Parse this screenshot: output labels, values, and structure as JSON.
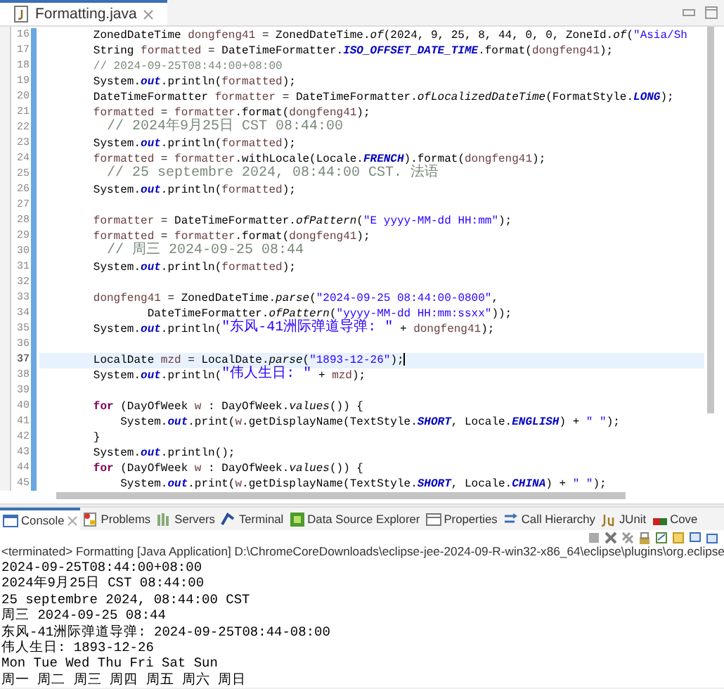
{
  "editor": {
    "tab": {
      "title": "Formatting.java",
      "selected": true
    },
    "lines": [
      {
        "number": "16",
        "current": false,
        "tokens": [
          {
            "text": "        ZonedDateTime ",
            "kind": "plain"
          },
          {
            "text": "dongfeng41",
            "kind": "variable"
          },
          {
            "text": " = ZonedDateTime.",
            "kind": "plain"
          },
          {
            "text": "of",
            "kind": "static-method"
          },
          {
            "text": "(2024, 9, 25, 8, 44, 0, 0, ZoneId.",
            "kind": "plain"
          },
          {
            "text": "of",
            "kind": "static-method"
          },
          {
            "text": "(",
            "kind": "plain"
          },
          {
            "text": "\"Asia/Sh",
            "kind": "string"
          }
        ]
      },
      {
        "number": "17",
        "current": false,
        "tokens": [
          {
            "text": "        String ",
            "kind": "plain"
          },
          {
            "text": "formatted",
            "kind": "variable"
          },
          {
            "text": " = DateTimeFormatter.",
            "kind": "plain"
          },
          {
            "text": "ISO_OFFSET_DATE_TIME",
            "kind": "constant"
          },
          {
            "text": ".format(",
            "kind": "plain"
          },
          {
            "text": "dongfeng41",
            "kind": "variable"
          },
          {
            "text": ");",
            "kind": "plain"
          }
        ]
      },
      {
        "number": "18",
        "current": false,
        "tokens": [
          {
            "text": "        // 2024-09-25T08:44:00+08:00",
            "kind": "comment"
          }
        ]
      },
      {
        "number": "19",
        "current": false,
        "tokens": [
          {
            "text": "        System.",
            "kind": "plain"
          },
          {
            "text": "out",
            "kind": "field"
          },
          {
            "text": ".println(",
            "kind": "plain"
          },
          {
            "text": "formatted",
            "kind": "variable"
          },
          {
            "text": ");",
            "kind": "plain"
          }
        ]
      },
      {
        "number": "20",
        "current": false,
        "tokens": [
          {
            "text": "        DateTimeFormatter ",
            "kind": "plain"
          },
          {
            "text": "formatter",
            "kind": "variable"
          },
          {
            "text": " = DateTimeFormatter.",
            "kind": "plain"
          },
          {
            "text": "ofLocalizedDateTime",
            "kind": "static-method"
          },
          {
            "text": "(FormatStyle.",
            "kind": "plain"
          },
          {
            "text": "LONG",
            "kind": "constant"
          },
          {
            "text": ");",
            "kind": "plain"
          }
        ]
      },
      {
        "number": "21",
        "current": false,
        "tokens": [
          {
            "text": "        formatted",
            "kind": "variable"
          },
          {
            "text": " = ",
            "kind": "plain"
          },
          {
            "text": "formatter",
            "kind": "variable"
          },
          {
            "text": ".format(",
            "kind": "plain"
          },
          {
            "text": "dongfeng41",
            "kind": "variable"
          },
          {
            "text": ");",
            "kind": "plain"
          }
        ]
      },
      {
        "number": "22",
        "current": false,
        "tokens": [
          {
            "text": "        // 2024年9月25日 CST 08:44:00",
            "kind": "comment"
          }
        ]
      },
      {
        "number": "23",
        "current": false,
        "tokens": [
          {
            "text": "        System.",
            "kind": "plain"
          },
          {
            "text": "out",
            "kind": "field"
          },
          {
            "text": ".println(",
            "kind": "plain"
          },
          {
            "text": "formatted",
            "kind": "variable"
          },
          {
            "text": ");",
            "kind": "plain"
          }
        ]
      },
      {
        "number": "24",
        "current": false,
        "tokens": [
          {
            "text": "        formatted",
            "kind": "variable"
          },
          {
            "text": " = ",
            "kind": "plain"
          },
          {
            "text": "formatter",
            "kind": "variable"
          },
          {
            "text": ".withLocale(Locale.",
            "kind": "plain"
          },
          {
            "text": "FRENCH",
            "kind": "constant"
          },
          {
            "text": ").format(",
            "kind": "plain"
          },
          {
            "text": "dongfeng41",
            "kind": "variable"
          },
          {
            "text": ");",
            "kind": "plain"
          }
        ]
      },
      {
        "number": "25",
        "current": false,
        "tokens": [
          {
            "text": "        // 25 septembre 2024, 08:44:00 CST. 法语",
            "kind": "comment"
          }
        ]
      },
      {
        "number": "26",
        "current": false,
        "tokens": [
          {
            "text": "        System.",
            "kind": "plain"
          },
          {
            "text": "out",
            "kind": "field"
          },
          {
            "text": ".println(",
            "kind": "plain"
          },
          {
            "text": "formatted",
            "kind": "variable"
          },
          {
            "text": ");",
            "kind": "plain"
          }
        ]
      },
      {
        "number": "27",
        "current": false
      },
      {
        "number": "28",
        "current": false,
        "tokens": [
          {
            "text": "        formatter",
            "kind": "variable"
          },
          {
            "text": " = DateTimeFormatter.",
            "kind": "plain"
          },
          {
            "text": "ofPattern",
            "kind": "static-method"
          },
          {
            "text": "(",
            "kind": "plain"
          },
          {
            "text": "\"E yyyy-MM-dd HH:mm\"",
            "kind": "string"
          },
          {
            "text": ");",
            "kind": "plain"
          }
        ]
      },
      {
        "number": "29",
        "current": false,
        "tokens": [
          {
            "text": "        formatted",
            "kind": "variable"
          },
          {
            "text": " = ",
            "kind": "plain"
          },
          {
            "text": "formatter",
            "kind": "variable"
          },
          {
            "text": ".format(",
            "kind": "plain"
          },
          {
            "text": "dongfeng41",
            "kind": "variable"
          },
          {
            "text": ");",
            "kind": "plain"
          }
        ]
      },
      {
        "number": "30",
        "current": false,
        "tokens": [
          {
            "text": "        // 周三 2024-09-25 08:44",
            "kind": "comment"
          }
        ]
      },
      {
        "number": "31",
        "current": false,
        "tokens": [
          {
            "text": "        System.",
            "kind": "plain"
          },
          {
            "text": "out",
            "kind": "field"
          },
          {
            "text": ".println(",
            "kind": "plain"
          },
          {
            "text": "formatted",
            "kind": "variable"
          },
          {
            "text": ");",
            "kind": "plain"
          }
        ]
      },
      {
        "number": "32",
        "current": false
      },
      {
        "number": "33",
        "current": false,
        "tokens": [
          {
            "text": "        dongfeng41",
            "kind": "variable"
          },
          {
            "text": " = ZonedDateTime.",
            "kind": "plain"
          },
          {
            "text": "parse",
            "kind": "static-method"
          },
          {
            "text": "(",
            "kind": "plain"
          },
          {
            "text": "\"2024-09-25 08:44:00-0800\"",
            "kind": "string"
          },
          {
            "text": ",",
            "kind": "plain"
          }
        ]
      },
      {
        "number": "34",
        "current": false,
        "tokens": [
          {
            "text": "                DateTimeFormatter.",
            "kind": "plain"
          },
          {
            "text": "ofPattern",
            "kind": "static-method"
          },
          {
            "text": "(",
            "kind": "plain"
          },
          {
            "text": "\"yyyy-MM-dd HH:mm:ssxx\"",
            "kind": "string"
          },
          {
            "text": "));",
            "kind": "plain"
          }
        ]
      },
      {
        "number": "35",
        "current": false,
        "tokens": [
          {
            "text": "        System.",
            "kind": "plain"
          },
          {
            "text": "out",
            "kind": "field"
          },
          {
            "text": ".println(",
            "kind": "plain"
          },
          {
            "text": "\"东风-41洲际弹道导弹: \"",
            "kind": "string"
          },
          {
            "text": " + ",
            "kind": "plain"
          },
          {
            "text": "dongfeng41",
            "kind": "variable"
          },
          {
            "text": ");",
            "kind": "plain"
          }
        ]
      },
      {
        "number": "36",
        "current": false
      },
      {
        "number": "37",
        "current": true,
        "tokens": [
          {
            "text": "        LocalDate ",
            "kind": "plain"
          },
          {
            "text": "mzd",
            "kind": "variable"
          },
          {
            "text": " = LocalDate.",
            "kind": "plain"
          },
          {
            "text": "parse",
            "kind": "static-method"
          },
          {
            "text": "(",
            "kind": "plain"
          },
          {
            "text": "\"1893-12-26\"",
            "kind": "string"
          },
          {
            "text": ");",
            "kind": "plain"
          }
        ]
      },
      {
        "number": "38",
        "current": false,
        "tokens": [
          {
            "text": "        System.",
            "kind": "plain"
          },
          {
            "text": "out",
            "kind": "field"
          },
          {
            "text": ".println(",
            "kind": "plain"
          },
          {
            "text": "\"伟人生日: \"",
            "kind": "string"
          },
          {
            "text": " + ",
            "kind": "plain"
          },
          {
            "text": "mzd",
            "kind": "variable"
          },
          {
            "text": ");",
            "kind": "plain"
          }
        ]
      },
      {
        "number": "39",
        "current": false
      },
      {
        "number": "40",
        "current": false,
        "tokens": [
          {
            "text": "        for",
            "kind": "keyword"
          },
          {
            "text": " (DayOfWeek ",
            "kind": "plain"
          },
          {
            "text": "w",
            "kind": "variable"
          },
          {
            "text": " : DayOfWeek.",
            "kind": "plain"
          },
          {
            "text": "values",
            "kind": "static-method"
          },
          {
            "text": "()) {",
            "kind": "plain"
          }
        ]
      },
      {
        "number": "41",
        "current": false,
        "tokens": [
          {
            "text": "            System.",
            "kind": "plain"
          },
          {
            "text": "out",
            "kind": "field"
          },
          {
            "text": ".print(",
            "kind": "plain"
          },
          {
            "text": "w",
            "kind": "variable"
          },
          {
            "text": ".getDisplayName(TextStyle.",
            "kind": "plain"
          },
          {
            "text": "SHORT",
            "kind": "constant"
          },
          {
            "text": ", Locale.",
            "kind": "plain"
          },
          {
            "text": "ENGLISH",
            "kind": "constant"
          },
          {
            "text": ") + ",
            "kind": "plain"
          },
          {
            "text": "\" \"",
            "kind": "string"
          },
          {
            "text": ");",
            "kind": "plain"
          }
        ]
      },
      {
        "number": "42",
        "current": false,
        "tokens": [
          {
            "text": "        }",
            "kind": "plain"
          }
        ]
      },
      {
        "number": "43",
        "current": false,
        "tokens": [
          {
            "text": "        System.",
            "kind": "plain"
          },
          {
            "text": "out",
            "kind": "field"
          },
          {
            "text": ".println();",
            "kind": "plain"
          }
        ]
      },
      {
        "number": "44",
        "current": false,
        "tokens": [
          {
            "text": "        for",
            "kind": "keyword"
          },
          {
            "text": " (DayOfWeek ",
            "kind": "plain"
          },
          {
            "text": "w",
            "kind": "variable"
          },
          {
            "text": " : DayOfWeek.",
            "kind": "plain"
          },
          {
            "text": "values",
            "kind": "static-method"
          },
          {
            "text": "()) {",
            "kind": "plain"
          }
        ]
      },
      {
        "number": "45",
        "current": false,
        "tokens": [
          {
            "text": "            System.",
            "kind": "plain"
          },
          {
            "text": "out",
            "kind": "field"
          },
          {
            "text": ".print(",
            "kind": "plain"
          },
          {
            "text": "w",
            "kind": "variable"
          },
          {
            "text": ".getDisplayName(TextStyle.",
            "kind": "plain"
          },
          {
            "text": "SHORT",
            "kind": "constant"
          },
          {
            "text": ", Locale.",
            "kind": "plain"
          },
          {
            "text": "CHINA",
            "kind": "constant"
          },
          {
            "text": ") + ",
            "kind": "plain"
          },
          {
            "text": "\" \"",
            "kind": "string"
          },
          {
            "text": ");",
            "kind": "plain"
          }
        ]
      }
    ]
  },
  "views": {
    "tabs": [
      {
        "label": "Console",
        "selected": true,
        "closable": true
      },
      {
        "label": "Problems",
        "selected": false,
        "closable": false
      },
      {
        "label": "Servers",
        "selected": false,
        "closable": false
      },
      {
        "label": "Terminal",
        "selected": false,
        "closable": false
      },
      {
        "label": "Data Source Explorer",
        "selected": false,
        "closable": false
      },
      {
        "label": "Properties",
        "selected": false,
        "closable": false
      },
      {
        "label": "Call Hierarchy",
        "selected": false,
        "closable": false
      },
      {
        "label": "JUnit",
        "selected": false,
        "closable": false
      },
      {
        "label": "Cove",
        "selected": false,
        "closable": false
      }
    ]
  },
  "console": {
    "header": "<terminated> Formatting [Java Application] D:\\ChromeCoreDownloads\\eclipse-jee-2024-09-R-win32-x86_64\\eclipse\\plugins\\org.eclipse",
    "output": [
      "2024-09-25T08:44:00+08:00",
      "2024年9月25日 CST 08:44:00",
      "25 septembre 2024, 08:44:00 CST",
      "周三 2024-09-25 08:44",
      "东风-41洲际弹道导弹: 2024-09-25T08:44-08:00",
      "伟人生日: 1893-12-26",
      "Mon Tue Wed Thu Fri Sat Sun",
      "周一 周二 周三 周四 周五 周六 周日"
    ]
  }
}
